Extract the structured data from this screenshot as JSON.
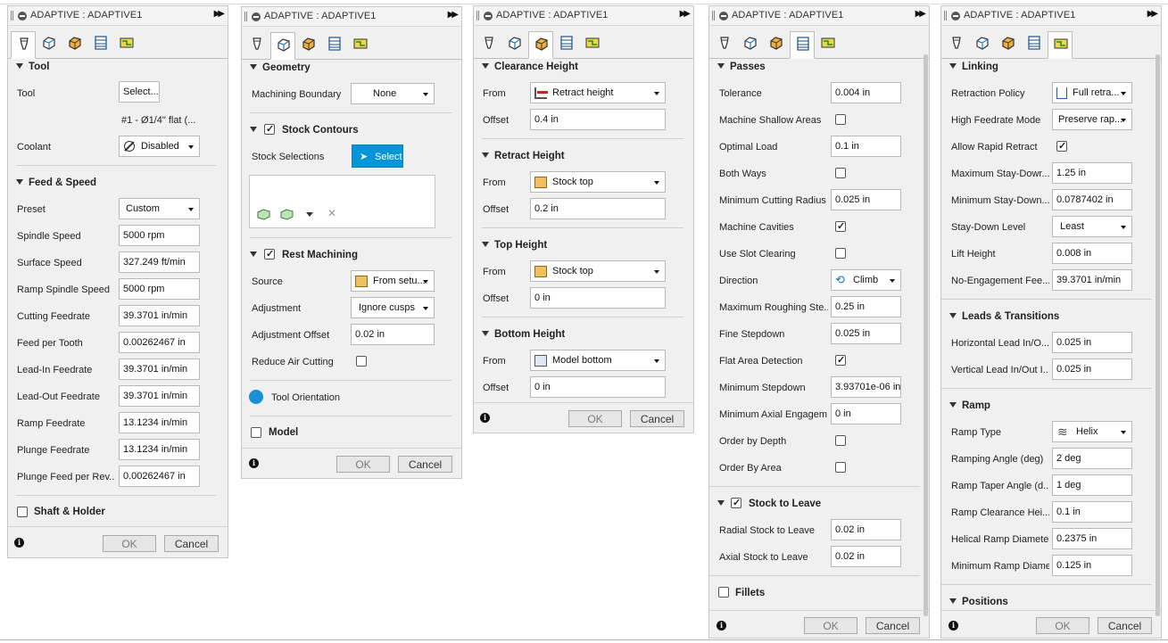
{
  "window_title": "ADAPTIVE : ADAPTIVE1",
  "buttons": {
    "ok": "OK",
    "cancel": "Cancel"
  },
  "icons": {
    "tab_icons": [
      "tool-tab-icon",
      "geometry-tab-icon",
      "heights-tab-icon",
      "passes-tab-icon",
      "linking-tab-icon"
    ],
    "accent": "#0696d7"
  },
  "panel1": {
    "tool_section": "Tool",
    "tool_label": "Tool",
    "tool_select": "Select...",
    "tool_desc": "#1 - Ø1/4\" flat (...",
    "coolant_label": "Coolant",
    "coolant_value": "Disabled",
    "feed_section": "Feed & Speed",
    "rows": [
      {
        "label": "Preset",
        "value": "Custom"
      },
      {
        "label": "Spindle Speed",
        "value": "5000 rpm"
      },
      {
        "label": "Surface Speed",
        "value": "327.249 ft/min"
      },
      {
        "label": "Ramp Spindle Speed",
        "value": "5000 rpm"
      },
      {
        "label": "Cutting Feedrate",
        "value": "39.3701 in/min"
      },
      {
        "label": "Feed per Tooth",
        "value": "0.00262467 in"
      },
      {
        "label": "Lead-In Feedrate",
        "value": "39.3701 in/min"
      },
      {
        "label": "Lead-Out Feedrate",
        "value": "39.3701 in/min"
      },
      {
        "label": "Ramp Feedrate",
        "value": "13.1234 in/min"
      },
      {
        "label": "Plunge Feedrate",
        "value": "13.1234 in/min"
      },
      {
        "label": "Plunge Feed per Rev...",
        "value": "0.00262467 in"
      }
    ],
    "shaft_section": "Shaft & Holder"
  },
  "panel2": {
    "geometry_section": "Geometry",
    "machining_boundary_label": "Machining Boundary",
    "machining_boundary_value": "None",
    "stock_contours_section": "Stock Contours",
    "stock_selections_label": "Stock Selections",
    "select_button": "Select",
    "rest_machining_section": "Rest Machining",
    "source_label": "Source",
    "source_value": "From setu...",
    "adjustment_label": "Adjustment",
    "adjustment_value": "Ignore cusps",
    "adjustment_offset_label": "Adjustment Offset",
    "adjustment_offset_value": "0.02 in",
    "reduce_air_label": "Reduce Air Cutting",
    "tool_orientation": "Tool Orientation",
    "model_section": "Model"
  },
  "panel3": {
    "from_label": "From",
    "offset_label": "Offset",
    "sections": [
      {
        "title": "Clearance Height",
        "from": "Retract height",
        "offset": "0.4 in"
      },
      {
        "title": "Retract Height",
        "from": "Stock top",
        "offset": "0.2 in"
      },
      {
        "title": "Top Height",
        "from": "Stock top",
        "offset": "0 in"
      },
      {
        "title": "Bottom Height",
        "from": "Model bottom",
        "offset": "0 in"
      }
    ]
  },
  "panel4": {
    "passes_section": "Passes",
    "rows": [
      {
        "label": "Tolerance",
        "value": "0.004 in"
      },
      {
        "label": "Machine Shallow Areas",
        "check": false
      },
      {
        "label": "Optimal Load",
        "value": "0.1 in"
      },
      {
        "label": "Both Ways",
        "check": false
      },
      {
        "label": "Minimum Cutting Radius",
        "value": "0.025 in"
      },
      {
        "label": "Machine Cavities",
        "check": true
      },
      {
        "label": "Use Slot Clearing",
        "check": false
      },
      {
        "label": "Direction",
        "value": "Climb"
      },
      {
        "label": "Maximum Roughing Ste...",
        "value": "0.25 in"
      },
      {
        "label": "Fine Stepdown",
        "value": "0.025 in"
      },
      {
        "label": "Flat Area Detection",
        "check": true
      },
      {
        "label": "Minimum Stepdown",
        "value": "3.93701e-06 in"
      },
      {
        "label": "Minimum Axial Engagem...",
        "value": "0 in"
      },
      {
        "label": "Order by Depth",
        "check": false
      },
      {
        "label": "Order By Area",
        "check": false
      }
    ],
    "stock_to_leave_section": "Stock to Leave",
    "radial_label": "Radial Stock to Leave",
    "radial_value": "0.02 in",
    "axial_label": "Axial Stock to Leave",
    "axial_value": "0.02 in",
    "fillets_section": "Fillets"
  },
  "panel5": {
    "linking_section": "Linking",
    "retraction_policy_label": "Retraction Policy",
    "retraction_policy_value": "Full retra...",
    "high_feedrate_label": "High Feedrate Mode",
    "high_feedrate_value": "Preserve rap...",
    "allow_rapid_label": "Allow Rapid Retract",
    "max_staydown_label": "Maximum Stay-Dowr...",
    "max_staydown_value": "1.25 in",
    "min_staydown_label": "Minimum Stay-Down...",
    "min_staydown_value": "0.0787402 in",
    "staydown_level_label": "Stay-Down Level",
    "staydown_level_value": "Least",
    "lift_height_label": "Lift Height",
    "lift_height_value": "0.008 in",
    "no_engagement_label": "No-Engagement Fee...",
    "no_engagement_value": "39.3701 in/min",
    "leads_section": "Leads & Transitions",
    "horizontal_lead_label": "Horizontal Lead In/O...",
    "horizontal_lead_value": "0.025 in",
    "vertical_lead_label": "Vertical Lead In/Out I...",
    "vertical_lead_value": "0.025 in",
    "ramp_section": "Ramp",
    "ramp_type_label": "Ramp Type",
    "ramp_type_value": "Helix",
    "ramping_angle_label": "Ramping Angle (deg)",
    "ramping_angle_value": "2 deg",
    "ramp_taper_label": "Ramp Taper Angle (d...",
    "ramp_taper_value": "1 deg",
    "ramp_clearance_label": "Ramp Clearance Hei...",
    "ramp_clearance_value": "0.1 in",
    "helical_diameter_label": "Helical Ramp Diameter",
    "helical_diameter_value": "0.2375 in",
    "min_ramp_diameter_label": "Minimum Ramp Diame...",
    "min_ramp_diameter_value": "0.125 in",
    "positions_section": "Positions"
  }
}
